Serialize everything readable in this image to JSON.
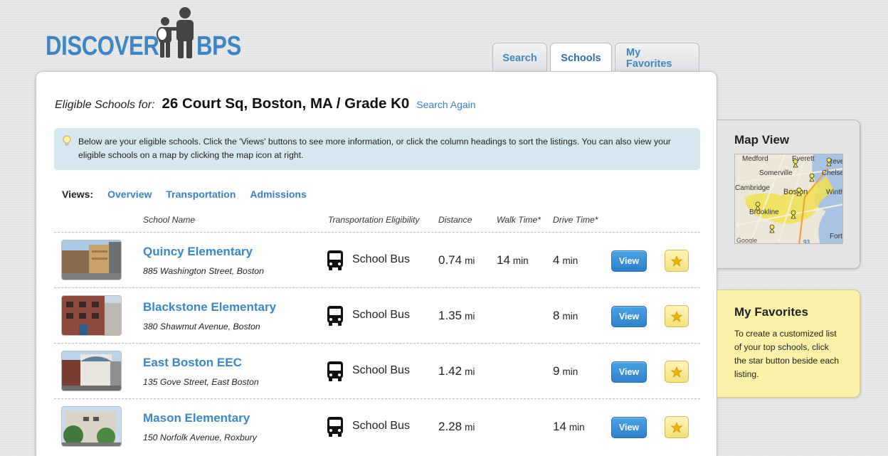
{
  "logo": {
    "left_text": "DISCOVER",
    "right_text": "BPS"
  },
  "tabs": [
    {
      "label": "Search",
      "active": false
    },
    {
      "label": "Schools",
      "active": true
    },
    {
      "label": "My Favorites",
      "active": false
    }
  ],
  "heading": {
    "label": "Eligible Schools for:",
    "address": "26 Court Sq, Boston, MA / Grade K0",
    "search_again": "Search Again"
  },
  "info": {
    "icon": "lightbulb-icon",
    "text": "Below are your eligible schools. Click the 'Views' buttons to see more information, or click the column headings to sort the listings. You can also view your eligible schools on a map by clicking the map icon at right."
  },
  "views": {
    "label": "Views:",
    "links": [
      "Overview",
      "Transportation",
      "Admissions"
    ]
  },
  "columns": {
    "school": "School Name",
    "transport": "Transportation Eligibility",
    "distance": "Distance",
    "walk": "Walk Time*",
    "drive": "Drive Time*"
  },
  "schools": [
    {
      "name": "Quincy Elementary",
      "address": "885 Washington Street, Boston",
      "transport": "School Bus",
      "distance": "0.74",
      "distance_unit": "mi",
      "walk": "14",
      "walk_unit": "min",
      "drive": "4",
      "drive_unit": "min",
      "view": "View"
    },
    {
      "name": "Blackstone Elementary",
      "address": "380 Shawmut Avenue, Boston",
      "transport": "School Bus",
      "distance": "1.35",
      "distance_unit": "mi",
      "walk": "",
      "walk_unit": "",
      "drive": "8",
      "drive_unit": "min",
      "view": "View"
    },
    {
      "name": "East Boston EEC",
      "address": "135 Gove Street, East Boston",
      "transport": "School Bus",
      "distance": "1.42",
      "distance_unit": "mi",
      "walk": "",
      "walk_unit": "",
      "drive": "9",
      "drive_unit": "min",
      "view": "View"
    },
    {
      "name": "Mason Elementary",
      "address": "150 Norfolk Avenue, Roxbury",
      "transport": "School Bus",
      "distance": "2.28",
      "distance_unit": "mi",
      "walk": "",
      "walk_unit": "",
      "drive": "14",
      "drive_unit": "min",
      "view": "View"
    }
  ],
  "map_panel": {
    "title": "Map View",
    "labels": [
      "Medford",
      "Everett",
      "Revere",
      "Somerville",
      "Chelsea",
      "Cambridge",
      "Boston",
      "Winthrop",
      "Brookline",
      "Fort",
      "Google",
      "93"
    ]
  },
  "favorites_panel": {
    "title": "My Favorites",
    "text": "To create a customized list of your top schools, click the star button beside each listing."
  },
  "colors": {
    "link_blue": "#3a86c8",
    "view_button": "#2f80cc",
    "info_bg": "#d6e7ef",
    "favorites_bg": "#fbf1a9"
  }
}
